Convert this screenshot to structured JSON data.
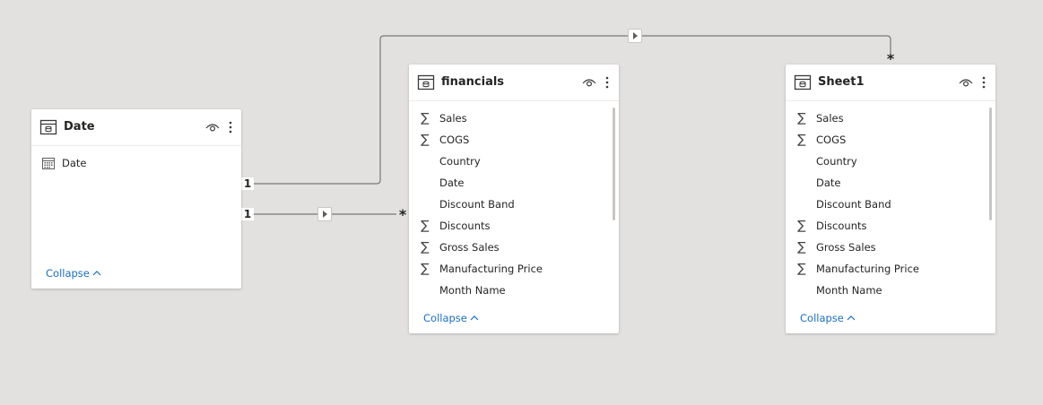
{
  "tables": [
    {
      "title": "Date",
      "fields": [
        {
          "label": "Date",
          "icon": "calendar-icon"
        }
      ],
      "collapse_label": "Collapse"
    },
    {
      "title": "financials",
      "fields": [
        {
          "label": "Sales",
          "icon": "sigma-icon"
        },
        {
          "label": "COGS",
          "icon": "sigma-icon"
        },
        {
          "label": "Country",
          "icon": ""
        },
        {
          "label": "Date",
          "icon": ""
        },
        {
          "label": "Discount Band",
          "icon": ""
        },
        {
          "label": "Discounts",
          "icon": "sigma-icon"
        },
        {
          "label": "Gross Sales",
          "icon": "sigma-icon"
        },
        {
          "label": "Manufacturing Price",
          "icon": "sigma-icon"
        },
        {
          "label": "Month Name",
          "icon": ""
        }
      ],
      "collapse_label": "Collapse"
    },
    {
      "title": "Sheet1",
      "fields": [
        {
          "label": "Sales",
          "icon": "sigma-icon"
        },
        {
          "label": "COGS",
          "icon": "sigma-icon"
        },
        {
          "label": "Country",
          "icon": ""
        },
        {
          "label": "Date",
          "icon": ""
        },
        {
          "label": "Discount Band",
          "icon": ""
        },
        {
          "label": "Discounts",
          "icon": "sigma-icon"
        },
        {
          "label": "Gross Sales",
          "icon": "sigma-icon"
        },
        {
          "label": "Manufacturing Price",
          "icon": "sigma-icon"
        },
        {
          "label": "Month Name",
          "icon": ""
        }
      ],
      "collapse_label": "Collapse"
    }
  ],
  "relationships": [
    {
      "from": "Date",
      "to": "Sheet1",
      "from_cardinality": "1",
      "to_cardinality": "*"
    },
    {
      "from": "Date",
      "to": "financials",
      "from_cardinality": "1",
      "to_cardinality": "*"
    }
  ],
  "colors": {
    "canvas": "#e3e1df",
    "card": "#ffffff",
    "link": "#1b6ec2",
    "line": "#7a7774"
  },
  "symbols": {
    "sigma": "∑",
    "chevron_up": "^"
  }
}
